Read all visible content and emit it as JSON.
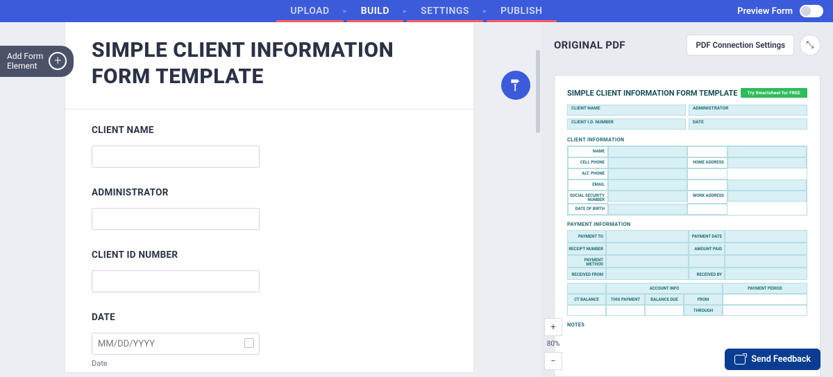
{
  "nav": {
    "upload": "UPLOAD",
    "build": "BUILD",
    "settings": "SETTINGS",
    "publish": "PUBLISH",
    "preview": "Preview Form"
  },
  "addbtn": {
    "line1": "Add Form",
    "line2": "Element"
  },
  "form": {
    "title": "SIMPLE CLIENT INFORMATION FORM TEMPLATE",
    "fields": {
      "client_name": "CLIENT NAME",
      "administrator": "ADMINISTRATOR",
      "client_id": "CLIENT ID NUMBER",
      "date": "DATE",
      "date_placeholder": "MM/DD/YYYY",
      "date_sub": "Date"
    }
  },
  "pdf": {
    "header": "ORIGINAL PDF",
    "settings_btn": "PDF Connection Settings",
    "zoom": "80%",
    "doc_title": "SIMPLE CLIENT INFORMATION FORM TEMPLATE",
    "try_btn": "Try Smartsheet for FREE",
    "top_labels": {
      "client_name": "CLIENT NAME",
      "administrator": "ADMINISTRATOR",
      "client_id": "CLIENT I.D. NUMBER",
      "date": "DATE"
    },
    "sec_info": "CLIENT INFORMATION",
    "info_labels": {
      "name": "NAME",
      "cell": "CELL PHONE",
      "alt": "ALT. PHONE",
      "email": "EMAIL",
      "ssn": "SOCIAL SECURITY NUMBER",
      "dob": "DATE OF BIRTH",
      "home": "HOME ADDRESS",
      "work": "WORK ADDRESS"
    },
    "sec_pay": "PAYMENT INFORMATION",
    "pay_labels": {
      "to": "PAYMENT TO",
      "date": "PAYMENT DATE",
      "receipt": "RECEIPT NUMBER",
      "amount": "AMOUNT PAID",
      "method": "PAYMENT METHOD",
      "from": "RECEIVED FROM",
      "by": "RECEIVED BY"
    },
    "acct": {
      "info": "ACCOUNT INFO",
      "period": "PAYMENT PERIOD",
      "bal": "CT BALANCE",
      "this": "THIS PAYMENT",
      "due": "BALANCE DUE",
      "afrom": "FROM",
      "through": "THROUGH"
    },
    "notes": "NOTES"
  },
  "feedback": "Send Feedback"
}
